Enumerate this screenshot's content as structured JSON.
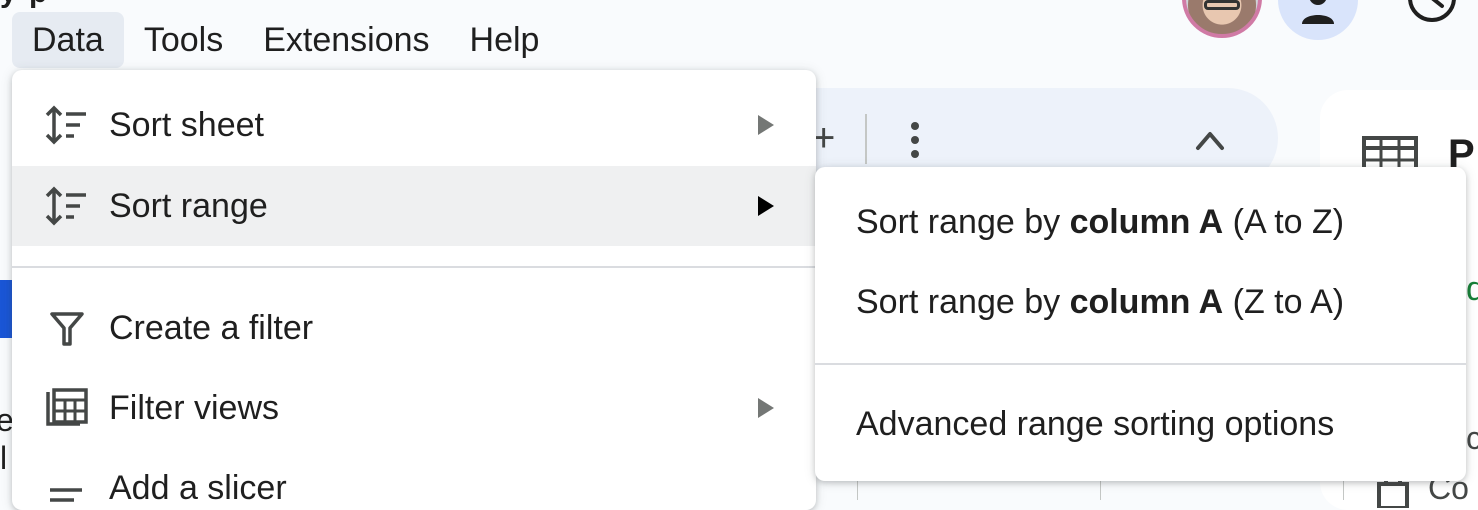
{
  "menubar": {
    "items": [
      "Data",
      "Tools",
      "Extensions",
      "Help"
    ],
    "active_index": 0
  },
  "data_menu": {
    "items": [
      {
        "label": "Sort sheet",
        "icon": "sort-icon",
        "has_submenu": true,
        "hovered": false
      },
      {
        "label": "Sort range",
        "icon": "sort-icon",
        "has_submenu": true,
        "hovered": true
      },
      {
        "label": "Create a filter",
        "icon": "filter-icon",
        "has_submenu": false,
        "hovered": false
      },
      {
        "label": "Filter views",
        "icon": "filter-views-icon",
        "has_submenu": true,
        "hovered": false
      },
      {
        "label": "Add a slicer",
        "icon": "slicer-icon",
        "has_submenu": false,
        "hovered": false
      }
    ]
  },
  "sort_range_submenu": {
    "items": [
      {
        "prefix": "Sort range by ",
        "bold": "column A",
        "suffix": " (A to Z)"
      },
      {
        "prefix": "Sort range by ",
        "bold": "column A",
        "suffix": " (Z to A)"
      },
      {
        "label": "Advanced range sorting options"
      }
    ]
  },
  "toolbar": {
    "add_label": "+",
    "more_icon": "more-vert-icon",
    "collapse_icon": "chevron-up-icon"
  },
  "side_panel": {
    "title_fragment": "P",
    "fragment_green": "d",
    "fragment_c": "c",
    "row_fragment": "Co"
  },
  "left_fragments": [
    "e",
    "l"
  ],
  "colors": {
    "menu_bg": "#ffffff",
    "hover_bg": "#eff0f1",
    "active_menubar_bg": "#e6ebf2",
    "page_bg": "#f9fbfd",
    "toolbar_bg": "#edf2fa",
    "accent_blue": "#1a56d6",
    "green": "#188038"
  }
}
